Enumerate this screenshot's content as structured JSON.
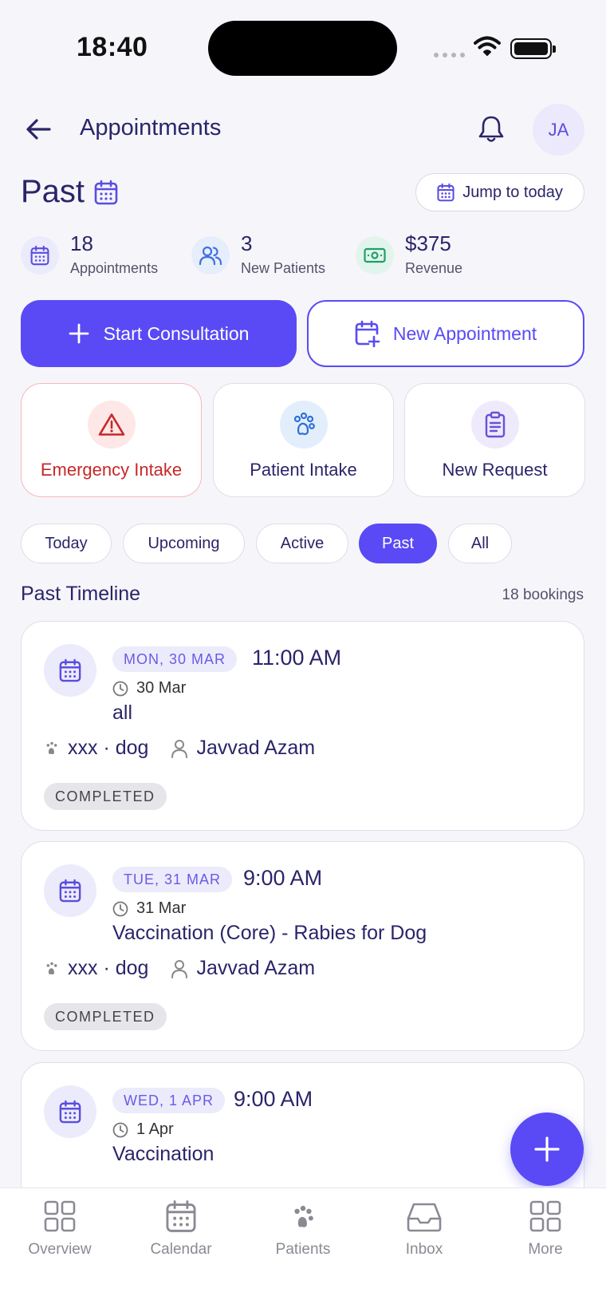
{
  "status_bar": {
    "time": "18:40"
  },
  "header": {
    "title": "Appointments",
    "avatar_initials": "JA",
    "back_icon": "arrow-left-icon",
    "bell_icon": "bell-icon"
  },
  "page": {
    "title": "Past",
    "jump_label": "Jump to today"
  },
  "stats": [
    {
      "value": "18",
      "label": "Appointments",
      "icon": "calendar-icon",
      "color": "#5b4de0"
    },
    {
      "value": "3",
      "label": "New Patients",
      "icon": "users-icon",
      "color": "#3f6fe0"
    },
    {
      "value": "$375",
      "label": "Revenue",
      "icon": "money-icon",
      "color": "#1e9e6a"
    }
  ],
  "actions": {
    "start_consultation": "Start Consultation",
    "new_appointment": "New Appointment"
  },
  "quick_actions": [
    {
      "label": "Emergency Intake",
      "icon": "warning-icon",
      "color": "#c62828"
    },
    {
      "label": "Patient Intake",
      "icon": "paw-icon",
      "color": "#2f6fd6"
    },
    {
      "label": "New Request",
      "icon": "clipboard-icon",
      "color": "#6a4fd8"
    }
  ],
  "filters": {
    "chips": [
      "Today",
      "Upcoming",
      "Active",
      "Past",
      "All"
    ],
    "selected": "Past"
  },
  "section": {
    "title": "Past Timeline",
    "count": "18 bookings"
  },
  "appointments": [
    {
      "date_pill": "MON, 30 MAR",
      "time": "11:00 AM",
      "sub_date": "30 Mar",
      "title": "all",
      "patient": "xxx · dog",
      "owner": "Javvad Azam",
      "status": "COMPLETED"
    },
    {
      "date_pill": "TUE, 31 MAR",
      "time": "9:00 AM",
      "sub_date": "31 Mar",
      "title": "Vaccination (Core) - Rabies for Dog",
      "patient": "xxx · dog",
      "owner": "Javvad Azam",
      "status": "COMPLETED"
    },
    {
      "date_pill": "WED, 1 APR",
      "time": "9:00 AM",
      "sub_date": "1 Apr",
      "title": "Vaccination",
      "patient": "",
      "owner": "",
      "status": ""
    }
  ],
  "bottom_nav": [
    {
      "label": "Overview",
      "icon": "grid-icon"
    },
    {
      "label": "Calendar",
      "icon": "calendar-icon"
    },
    {
      "label": "Patients",
      "icon": "paw-icon"
    },
    {
      "label": "Inbox",
      "icon": "inbox-icon"
    },
    {
      "label": "More",
      "icon": "grid-icon"
    }
  ],
  "colors": {
    "accent": "#594af5",
    "text_primary": "#2a2569",
    "emergency": "#c62828",
    "background": "#f6f6fa"
  }
}
